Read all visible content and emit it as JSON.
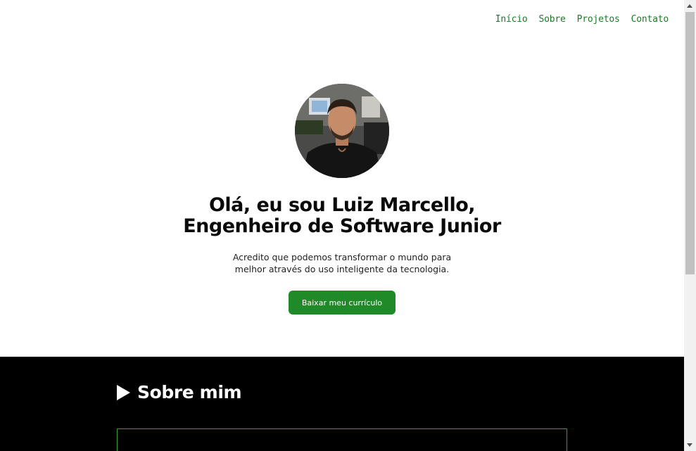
{
  "nav": {
    "items": [
      "Início",
      "Sobre",
      "Projetos",
      "Contato"
    ]
  },
  "hero": {
    "title_line1": "Olá, eu sou Luiz Marcello,",
    "title_line2": "Engenheiro de Software Junior",
    "subtitle_line1": "Acredito que podemos transformar o mundo para",
    "subtitle_line2": "melhor através do uso inteligente da tecnologia.",
    "cv_button": "Baixar meu currículo"
  },
  "about": {
    "heading": "Sobre mim"
  },
  "colors": {
    "accent": "#1f8a27",
    "nav_text": "#1e7a26",
    "about_background": "#000000",
    "about_border": "#2fa33a"
  },
  "icons": {
    "about_heading_icon": "play-triangle-icon"
  }
}
